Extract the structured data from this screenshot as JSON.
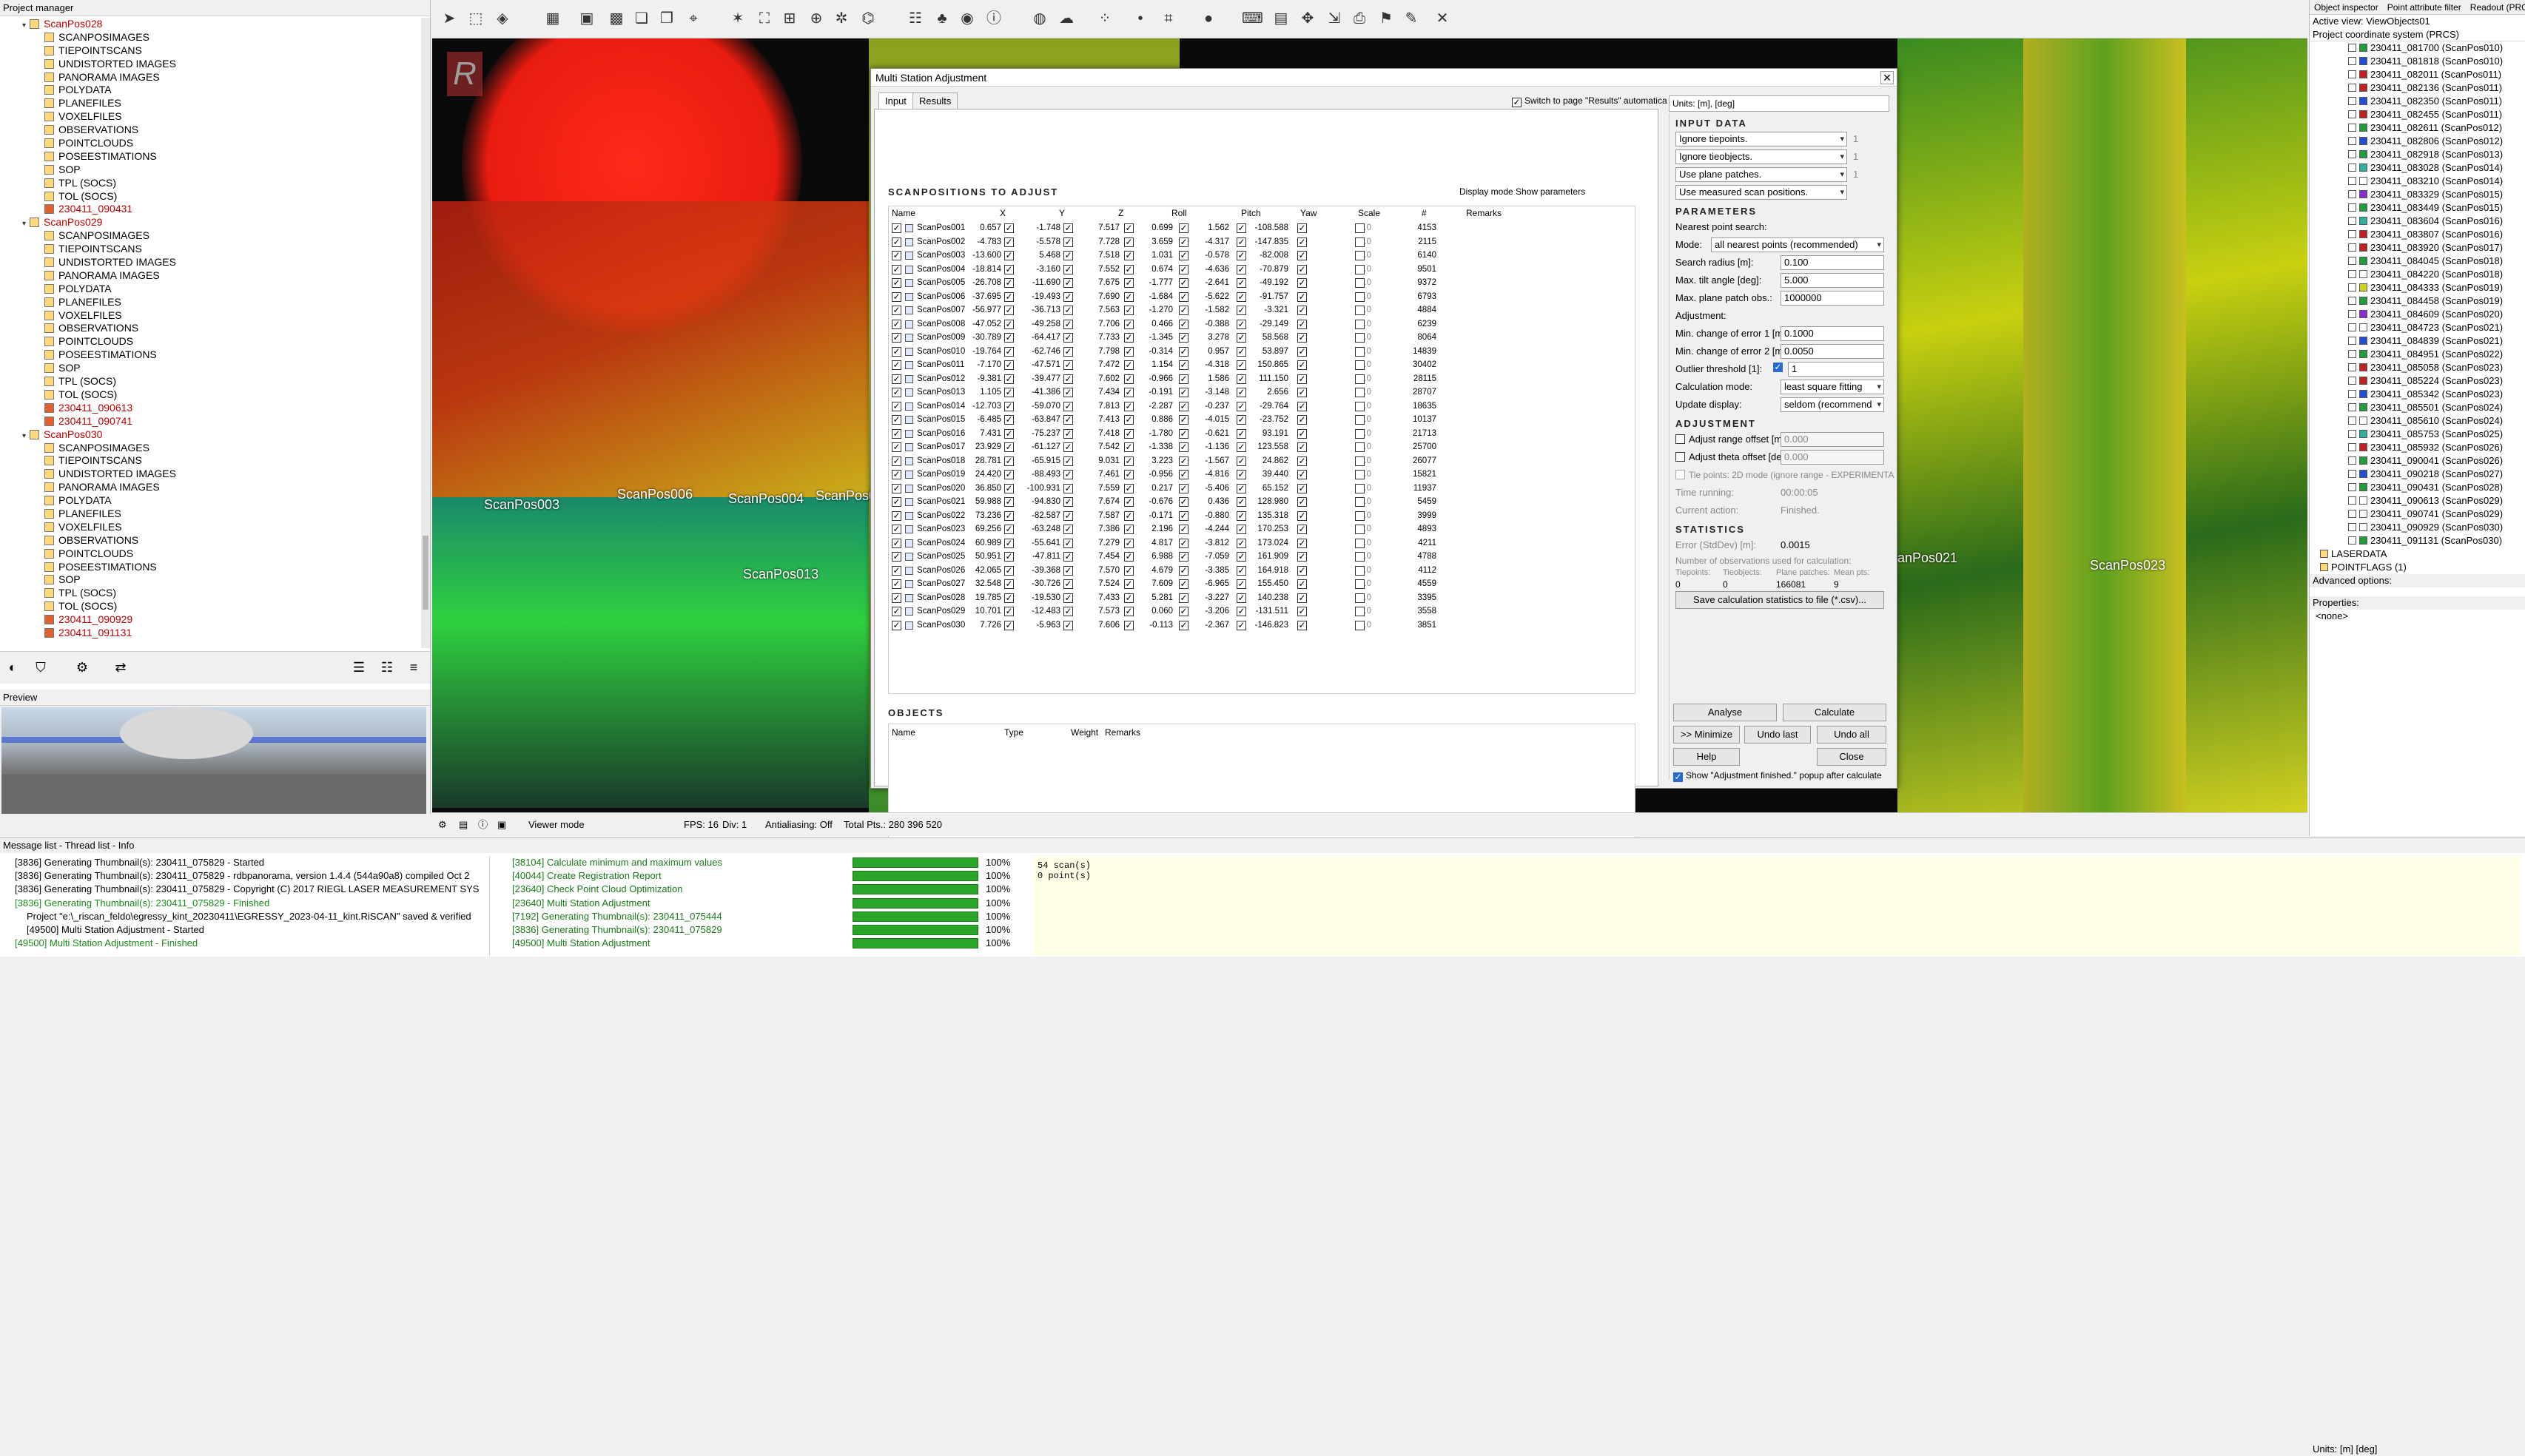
{
  "project_manager": {
    "title": "Project manager",
    "tree": [
      {
        "label": "ScanPos028",
        "level": 1,
        "red": true,
        "expand": "▾"
      },
      {
        "label": "SCANPOSIMAGES",
        "level": 2
      },
      {
        "label": "TIEPOINTSCANS",
        "level": 2
      },
      {
        "label": "UNDISTORTED IMAGES",
        "level": 2
      },
      {
        "label": "PANORAMA IMAGES",
        "level": 2
      },
      {
        "label": "POLYDATA",
        "level": 2
      },
      {
        "label": "PLANEFILES",
        "level": 2
      },
      {
        "label": "VOXELFILES",
        "level": 2
      },
      {
        "label": "OBSERVATIONS",
        "level": 2
      },
      {
        "label": "POINTCLOUDS",
        "level": 2
      },
      {
        "label": "POSEESTIMATIONS",
        "level": 2
      },
      {
        "label": "SOP",
        "level": 2
      },
      {
        "label": "TPL (SOCS)",
        "level": 2
      },
      {
        "label": "TOL (SOCS)",
        "level": 2
      },
      {
        "label": "230411_090431",
        "level": 2,
        "red": true
      },
      {
        "label": "ScanPos029",
        "level": 1,
        "red": true,
        "expand": "▾"
      },
      {
        "label": "SCANPOSIMAGES",
        "level": 2
      },
      {
        "label": "TIEPOINTSCANS",
        "level": 2
      },
      {
        "label": "UNDISTORTED IMAGES",
        "level": 2
      },
      {
        "label": "PANORAMA IMAGES",
        "level": 2
      },
      {
        "label": "POLYDATA",
        "level": 2
      },
      {
        "label": "PLANEFILES",
        "level": 2
      },
      {
        "label": "VOXELFILES",
        "level": 2
      },
      {
        "label": "OBSERVATIONS",
        "level": 2
      },
      {
        "label": "POINTCLOUDS",
        "level": 2
      },
      {
        "label": "POSEESTIMATIONS",
        "level": 2
      },
      {
        "label": "SOP",
        "level": 2
      },
      {
        "label": "TPL (SOCS)",
        "level": 2
      },
      {
        "label": "TOL (SOCS)",
        "level": 2
      },
      {
        "label": "230411_090613",
        "level": 2,
        "red": true
      },
      {
        "label": "230411_090741",
        "level": 2,
        "red": true
      },
      {
        "label": "ScanPos030",
        "level": 1,
        "red": true,
        "expand": "▾"
      },
      {
        "label": "SCANPOSIMAGES",
        "level": 2
      },
      {
        "label": "TIEPOINTSCANS",
        "level": 2
      },
      {
        "label": "UNDISTORTED IMAGES",
        "level": 2
      },
      {
        "label": "PANORAMA IMAGES",
        "level": 2
      },
      {
        "label": "POLYDATA",
        "level": 2
      },
      {
        "label": "PLANEFILES",
        "level": 2
      },
      {
        "label": "VOXELFILES",
        "level": 2
      },
      {
        "label": "OBSERVATIONS",
        "level": 2
      },
      {
        "label": "POINTCLOUDS",
        "level": 2
      },
      {
        "label": "POSEESTIMATIONS",
        "level": 2
      },
      {
        "label": "SOP",
        "level": 2
      },
      {
        "label": "TPL (SOCS)",
        "level": 2
      },
      {
        "label": "TOL (SOCS)",
        "level": 2
      },
      {
        "label": "230411_090929",
        "level": 2,
        "red": true
      },
      {
        "label": "230411_091131",
        "level": 2,
        "red": true
      }
    ]
  },
  "preview": {
    "title": "Preview"
  },
  "status_bar": {
    "viewer_mode": "Viewer mode",
    "fps": "FPS: 16",
    "div": "Div: 1",
    "antialiasing": "Antialiasing: Off",
    "total_pts": "Total Pts.: 280 396 520",
    "units": "Units: [m] [deg]"
  },
  "viewer_labels": [
    "ScanPos003",
    "ScanPos006",
    "ScanPos004",
    "ScanPos0",
    "ScanPos013",
    "anPos021",
    "ScanPos023"
  ],
  "right_panel": {
    "tabs": [
      "Object inspector",
      "Point attribute filter",
      "Readout (PRCS)"
    ],
    "active_view": "Active view: ViewObjects01",
    "coord": "Project coordinate system (PRCS)",
    "items": [
      {
        "label": "230411_081700 (ScanPos010)",
        "color": "#1f9e3a"
      },
      {
        "label": "230411_081818 (ScanPos010)",
        "color": "#1f50d0"
      },
      {
        "label": "230411_082011 (ScanPos011)",
        "color": "#c02020"
      },
      {
        "label": "230411_082136 (ScanPos011)",
        "color": "#c02020"
      },
      {
        "label": "230411_082350 (ScanPos011)",
        "color": "#1f50d0"
      },
      {
        "label": "230411_082455 (ScanPos011)",
        "color": "#c02020"
      },
      {
        "label": "230411_082611 (ScanPos012)",
        "color": "#1f9e3a"
      },
      {
        "label": "230411_082806 (ScanPos012)",
        "color": "#1f50d0"
      },
      {
        "label": "230411_082918 (ScanPos013)",
        "color": "#1f9e3a"
      },
      {
        "label": "230411_083028 (ScanPos014)",
        "color": "#2fb0a0"
      },
      {
        "label": "230411_083210 (ScanPos014)",
        "color": "#ffffff"
      },
      {
        "label": "230411_083329 (ScanPos015)",
        "color": "#8a2ad0"
      },
      {
        "label": "230411_083449 (ScanPos015)",
        "color": "#1f9e3a"
      },
      {
        "label": "230411_083604 (ScanPos016)",
        "color": "#2fb0a0"
      },
      {
        "label": "230411_083807 (ScanPos016)",
        "color": "#c02020"
      },
      {
        "label": "230411_083920 (ScanPos017)",
        "color": "#c02020"
      },
      {
        "label": "230411_084045 (ScanPos018)",
        "color": "#1f9e3a"
      },
      {
        "label": "230411_084220 (ScanPos018)",
        "color": "#ffffff"
      },
      {
        "label": "230411_084333 (ScanPos019)",
        "color": "#d0d020"
      },
      {
        "label": "230411_084458 (ScanPos019)",
        "color": "#1f9e3a"
      },
      {
        "label": "230411_084609 (ScanPos020)",
        "color": "#8a2ad0"
      },
      {
        "label": "230411_084723 (ScanPos021)",
        "color": "#ffffff"
      },
      {
        "label": "230411_084839 (ScanPos021)",
        "color": "#1f50d0"
      },
      {
        "label": "230411_084951 (ScanPos022)",
        "color": "#1f9e3a"
      },
      {
        "label": "230411_085058 (ScanPos023)",
        "color": "#c02020"
      },
      {
        "label": "230411_085224 (ScanPos023)",
        "color": "#c02020"
      },
      {
        "label": "230411_085342 (ScanPos023)",
        "color": "#1f50d0"
      },
      {
        "label": "230411_085501 (ScanPos024)",
        "color": "#1f9e3a"
      },
      {
        "label": "230411_085610 (ScanPos024)",
        "color": "#ffffff"
      },
      {
        "label": "230411_085753 (ScanPos025)",
        "color": "#2fb0a0"
      },
      {
        "label": "230411_085932 (ScanPos026)",
        "color": "#c02020"
      },
      {
        "label": "230411_090041 (ScanPos026)",
        "color": "#1f9e3a"
      },
      {
        "label": "230411_090218 (ScanPos027)",
        "color": "#1f50d0"
      },
      {
        "label": "230411_090431 (ScanPos028)",
        "color": "#1f9e3a"
      },
      {
        "label": "230411_090613 (ScanPos029)",
        "color": "#ffffff"
      },
      {
        "label": "230411_090741 (ScanPos029)",
        "color": "#ffffff"
      },
      {
        "label": "230411_090929 (ScanPos030)",
        "color": "#ffffff"
      },
      {
        "label": "230411_091131 (ScanPos030)",
        "color": "#1f9e3a"
      }
    ],
    "laserdata": "LASERDATA",
    "pointflags": "POINTFLAGS (1)",
    "advanced": "Advanced options:",
    "properties": "Properties:",
    "none": "<none>",
    "units": "Units: [m] [deg]"
  },
  "messages": {
    "title": "Message list - Thread list - Info",
    "log": [
      "[3836] Generating Thumbnail(s): 230411_075829 - Started",
      "[3836] Generating Thumbnail(s): 230411_075829 - rdbpanorama, version 1.4.4 (544a90a8)   compiled Oct 2",
      "[3836] Generating Thumbnail(s): 230411_075829 - Copyright (C) 2017 RIEGL LASER MEASUREMENT SYS",
      "[3836] Generating Thumbnail(s): 230411_075829 - Finished",
      "Project \"e:\\_riscan_feldo\\egressy_kint_20230411\\EGRESSY_2023-04-11_kint.RiSCAN\" saved & verified",
      "[49500] Multi Station Adjustment - Started",
      "[49500] Multi Station Adjustment - Finished"
    ],
    "threads": [
      {
        "label": "[38104] Calculate minimum and maximum values",
        "pct": "100%"
      },
      {
        "label": "[40044] Create Registration Report",
        "pct": "100%"
      },
      {
        "label": "[23640] Check Point Cloud Optimization",
        "pct": "100%"
      },
      {
        "label": "[23640] Multi Station Adjustment",
        "pct": "100%"
      },
      {
        "label": "[7192] Generating Thumbnail(s): 230411_075444",
        "pct": "100%"
      },
      {
        "label": "[3836] Generating Thumbnail(s): 230411_075829",
        "pct": "100%"
      },
      {
        "label": "[49500] Multi Station Adjustment",
        "pct": "100%"
      }
    ],
    "info": [
      "54 scan(s)",
      "0 point(s)"
    ]
  },
  "dialog": {
    "title": "Multi Station Adjustment",
    "tabs": [
      "Input",
      "Results"
    ],
    "switch_label": "Switch to page \"Results\" automatica",
    "scanpositions_title": "SCANPOSITIONS TO ADJUST",
    "display_mode": "Display mode Show parameters",
    "columns": [
      "Name",
      "X",
      "Y",
      "Z",
      "Roll",
      "Pitch",
      "Yaw",
      "Scale",
      "#",
      "Remarks"
    ],
    "rows": [
      [
        "ScanPos001",
        "0.657",
        "-1.748",
        "7.517",
        "0.699",
        "1.562",
        "-108.588",
        "0.0",
        "4153"
      ],
      [
        "ScanPos002",
        "-4.783",
        "-5.578",
        "7.728",
        "3.659",
        "-4.317",
        "-147.835",
        "0.0",
        "2115"
      ],
      [
        "ScanPos003",
        "-13.600",
        "5.468",
        "7.518",
        "1.031",
        "-0.578",
        "-82.008",
        "0.0",
        "6140"
      ],
      [
        "ScanPos004",
        "-18.814",
        "-3.160",
        "7.552",
        "0.674",
        "-4.636",
        "-70.879",
        "0.0",
        "9501"
      ],
      [
        "ScanPos005",
        "-26.708",
        "-11.690",
        "7.675",
        "-1.777",
        "-2.641",
        "-49.192",
        "0.0",
        "9372"
      ],
      [
        "ScanPos006",
        "-37.695",
        "-19.493",
        "7.690",
        "-1.684",
        "-5.622",
        "-91.757",
        "0.0",
        "6793"
      ],
      [
        "ScanPos007",
        "-56.977",
        "-36.713",
        "7.563",
        "-1.270",
        "-1.582",
        "-3.321",
        "0.0",
        "4884"
      ],
      [
        "ScanPos008",
        "-47.052",
        "-49.258",
        "7.706",
        "0.466",
        "-0.388",
        "-29.149",
        "0.0",
        "6239"
      ],
      [
        "ScanPos009",
        "-30.789",
        "-64.417",
        "7.733",
        "-1.345",
        "3.278",
        "58.568",
        "0.0",
        "8064"
      ],
      [
        "ScanPos010",
        "-19.764",
        "-62.746",
        "7.798",
        "-0.314",
        "0.957",
        "53.897",
        "0.0",
        "14839"
      ],
      [
        "ScanPos011",
        "-7.170",
        "-47.571",
        "7.472",
        "1.154",
        "-4.318",
        "150.865",
        "0.0",
        "30402"
      ],
      [
        "ScanPos012",
        "-9.381",
        "-39.477",
        "7.602",
        "-0.966",
        "1.586",
        "111.150",
        "0.0",
        "28115"
      ],
      [
        "ScanPos013",
        "1.105",
        "-41.386",
        "7.434",
        "-0.191",
        "-3.148",
        "2.656",
        "0.0",
        "28707"
      ],
      [
        "ScanPos014",
        "-12.703",
        "-59.070",
        "7.813",
        "-2.287",
        "-0.237",
        "-29.764",
        "0.0",
        "18635"
      ],
      [
        "ScanPos015",
        "-6.485",
        "-63.847",
        "7.413",
        "0.886",
        "-4.015",
        "-23.752",
        "0.0",
        "10137"
      ],
      [
        "ScanPos016",
        "7.431",
        "-75.237",
        "7.418",
        "-1.780",
        "-0.621",
        "93.191",
        "0.0",
        "21713"
      ],
      [
        "ScanPos017",
        "23.929",
        "-61.127",
        "7.542",
        "-1.338",
        "-1.136",
        "123.558",
        "0.0",
        "25700"
      ],
      [
        "ScanPos018",
        "28.781",
        "-65.915",
        "9.031",
        "3.223",
        "-1.567",
        "24.862",
        "0.0",
        "26077"
      ],
      [
        "ScanPos019",
        "24.420",
        "-88.493",
        "7.461",
        "-0.956",
        "-4.816",
        "39.440",
        "0.0",
        "15821"
      ],
      [
        "ScanPos020",
        "36.850",
        "-100.931",
        "7.559",
        "0.217",
        "-5.406",
        "65.152",
        "0.0",
        "11937"
      ],
      [
        "ScanPos021",
        "59.988",
        "-94.830",
        "7.674",
        "-0.676",
        "0.436",
        "128.980",
        "0.0",
        "5459"
      ],
      [
        "ScanPos022",
        "73.236",
        "-82.587",
        "7.587",
        "-0.171",
        "-0.880",
        "135.318",
        "0.0",
        "3999"
      ],
      [
        "ScanPos023",
        "69.256",
        "-63.248",
        "7.386",
        "2.196",
        "-4.244",
        "170.253",
        "0.0",
        "4893"
      ],
      [
        "ScanPos024",
        "60.989",
        "-55.641",
        "7.279",
        "4.817",
        "-3.812",
        "173.024",
        "0.0",
        "4211"
      ],
      [
        "ScanPos025",
        "50.951",
        "-47.811",
        "7.454",
        "6.988",
        "-7.059",
        "161.909",
        "0.0",
        "4788"
      ],
      [
        "ScanPos026",
        "42.065",
        "-39.368",
        "7.570",
        "4.679",
        "-3.385",
        "164.918",
        "0.0",
        "4112"
      ],
      [
        "ScanPos027",
        "32.548",
        "-30.726",
        "7.524",
        "7.609",
        "-6.965",
        "155.450",
        "0.0",
        "4559"
      ],
      [
        "ScanPos028",
        "19.785",
        "-19.530",
        "7.433",
        "5.281",
        "-3.227",
        "140.238",
        "0.0",
        "3395"
      ],
      [
        "ScanPos029",
        "10.701",
        "-12.483",
        "7.573",
        "0.060",
        "-3.206",
        "-131.511",
        "0.0",
        "3558"
      ],
      [
        "ScanPos030",
        "7.726",
        "-5.963",
        "7.606",
        "-0.113",
        "-2.367",
        "-146.823",
        "0.0",
        "3851"
      ]
    ],
    "objects_title": "OBJECTS",
    "obj_columns": [
      "Name",
      "Type",
      "Weight",
      "Remarks"
    ],
    "units": "Units: [m], [deg]",
    "input_data": "INPUT DATA",
    "inputs": [
      "Ignore tiepoints.",
      "Ignore tieobjects.",
      "Use plane patches.",
      "Use measured scan positions."
    ],
    "input_vals": [
      "1",
      "1",
      "1",
      ""
    ],
    "parameters": "PARAMETERS",
    "nearest": "Nearest point search:",
    "mode_label": "Mode:",
    "mode_val": "all nearest points (recommended)",
    "search_radius_label": "Search radius [m]:",
    "search_radius": "0.100",
    "max_tilt_label": "Max. tilt angle [deg]:",
    "max_tilt": "5.000",
    "max_patch_label": "Max. plane patch obs.:",
    "max_patch": "1000000",
    "adjustment_label": "Adjustment:",
    "min_err1_label": "Min. change of error 1 [m]:",
    "min_err1": "0.1000",
    "min_err2_label": "Min. change of error 2 [m]:",
    "min_err2": "0.0050",
    "outlier_label": "Outlier threshold [1]:",
    "outlier": "1",
    "calc_mode_label": "Calculation mode:",
    "calc_mode": "least square fitting",
    "update_label": "Update display:",
    "update": "seldom (recommend",
    "adjustment_title": "ADJUSTMENT",
    "adj_range_label": "Adjust range offset [m]",
    "adj_range": "0.000",
    "adj_theta_label": "Adjust theta offset [deg]",
    "adj_theta": "0.000",
    "tie2d": "Tie points: 2D mode (ignore range - EXPERIMENTA",
    "time_label": "Time running:",
    "time": "00:00:05",
    "action_label": "Current action:",
    "action": "Finished.",
    "statistics": "STATISTICS",
    "error_label": "Error (StdDev) [m]:",
    "error": "0.0015",
    "nobs": "Number of observations used for calculation:",
    "nobs_cols": [
      "Tiepoints:",
      "Tieobjects:",
      "Plane patches:",
      "Mean pts:"
    ],
    "nobs_vals": [
      "0",
      "0",
      "166081",
      "9"
    ],
    "save_stats": "Save calculation statistics to file (*.csv)...",
    "analyse": "Analyse",
    "calculate": "Calculate",
    "minimize": ">> Minimize",
    "undo_last": "Undo last",
    "undo_all": "Undo all",
    "help": "Help",
    "close": "Close",
    "show_popup": "Show \"Adjustment finished.\" popup after calculate"
  }
}
